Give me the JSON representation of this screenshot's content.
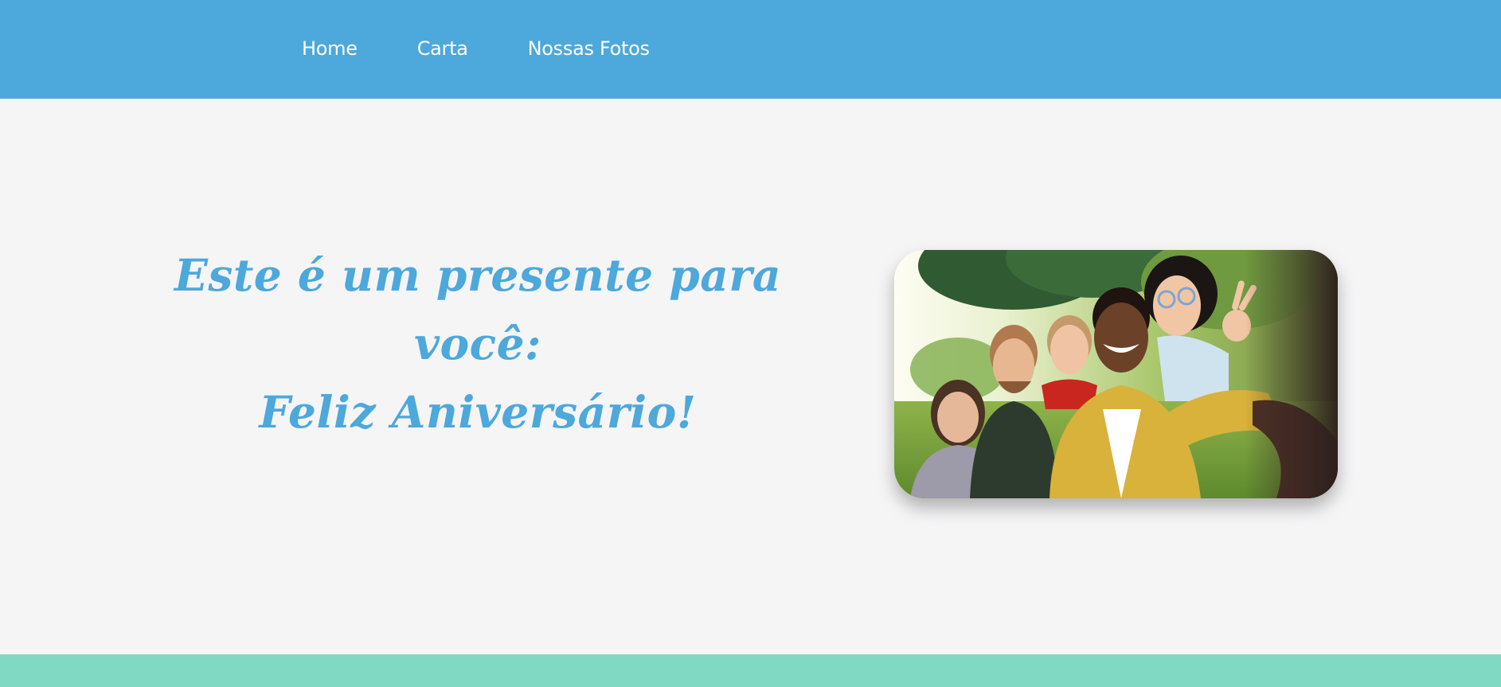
{
  "nav": {
    "links": [
      {
        "label": "Home"
      },
      {
        "label": "Carta"
      },
      {
        "label": "Nossas Fotos"
      }
    ]
  },
  "hero": {
    "line1": "Este é um presente para você:",
    "line2": "Feliz Aniversário!",
    "image_alt": "Grupo de amigos sorrindo tirando uma selfie no parque"
  },
  "colors": {
    "navbar": "#4da8db",
    "background": "#f5f5f6",
    "accent_text": "#4da8db",
    "footer": "#80d9c3"
  }
}
